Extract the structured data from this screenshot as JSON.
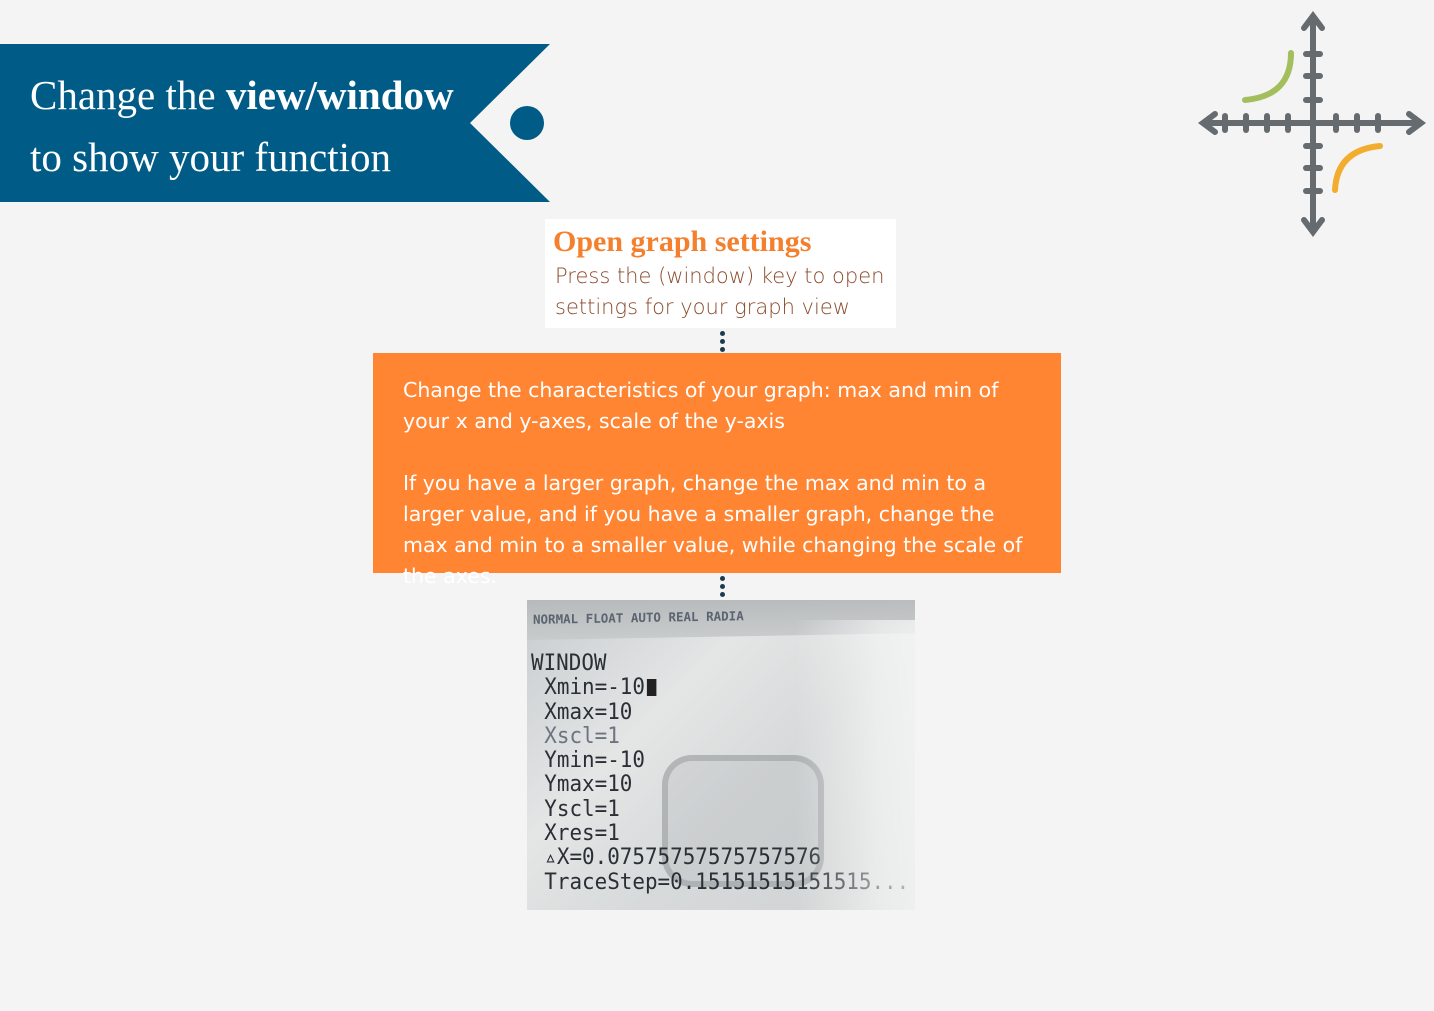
{
  "banner": {
    "line1_prefix": "Change the ",
    "line1_bold": "view/window",
    "line2": "to show your function",
    "color": "#005b87"
  },
  "icon": {
    "name": "coordinate-axes-icon",
    "colors": {
      "axes": "#666b70",
      "curve_top": "#a3be5c",
      "curve_bottom": "#f2ad2e"
    }
  },
  "callout": {
    "title": "Open graph settings",
    "body": "Press the (window) key to open settings for your graph view",
    "title_color": "#f47f2c"
  },
  "info_box": {
    "paragraph1": "Change the characteristics of your graph: max and min of your x and y-axes, scale of the y-axis",
    "paragraph2": "If you have a larger graph, change the max and min to a larger value, and if you have a smaller graph, change the max and min to a smaller value, while changing the scale of the axes.",
    "color": "#ff8533"
  },
  "calculator": {
    "status": "NORMAL FLOAT AUTO REAL RADIA",
    "title": "WINDOW",
    "xmin": "Xmin=-10",
    "xmax": "Xmax=10",
    "xscl": "Xscl=1",
    "ymin": "Ymin=-10",
    "ymax": "Ymax=10",
    "yscl": "Yscl=1",
    "xres": "Xres=1",
    "deltax": "▵X=0.07575757575757576",
    "tracestep": "TraceStep=0.15151515151515..."
  }
}
